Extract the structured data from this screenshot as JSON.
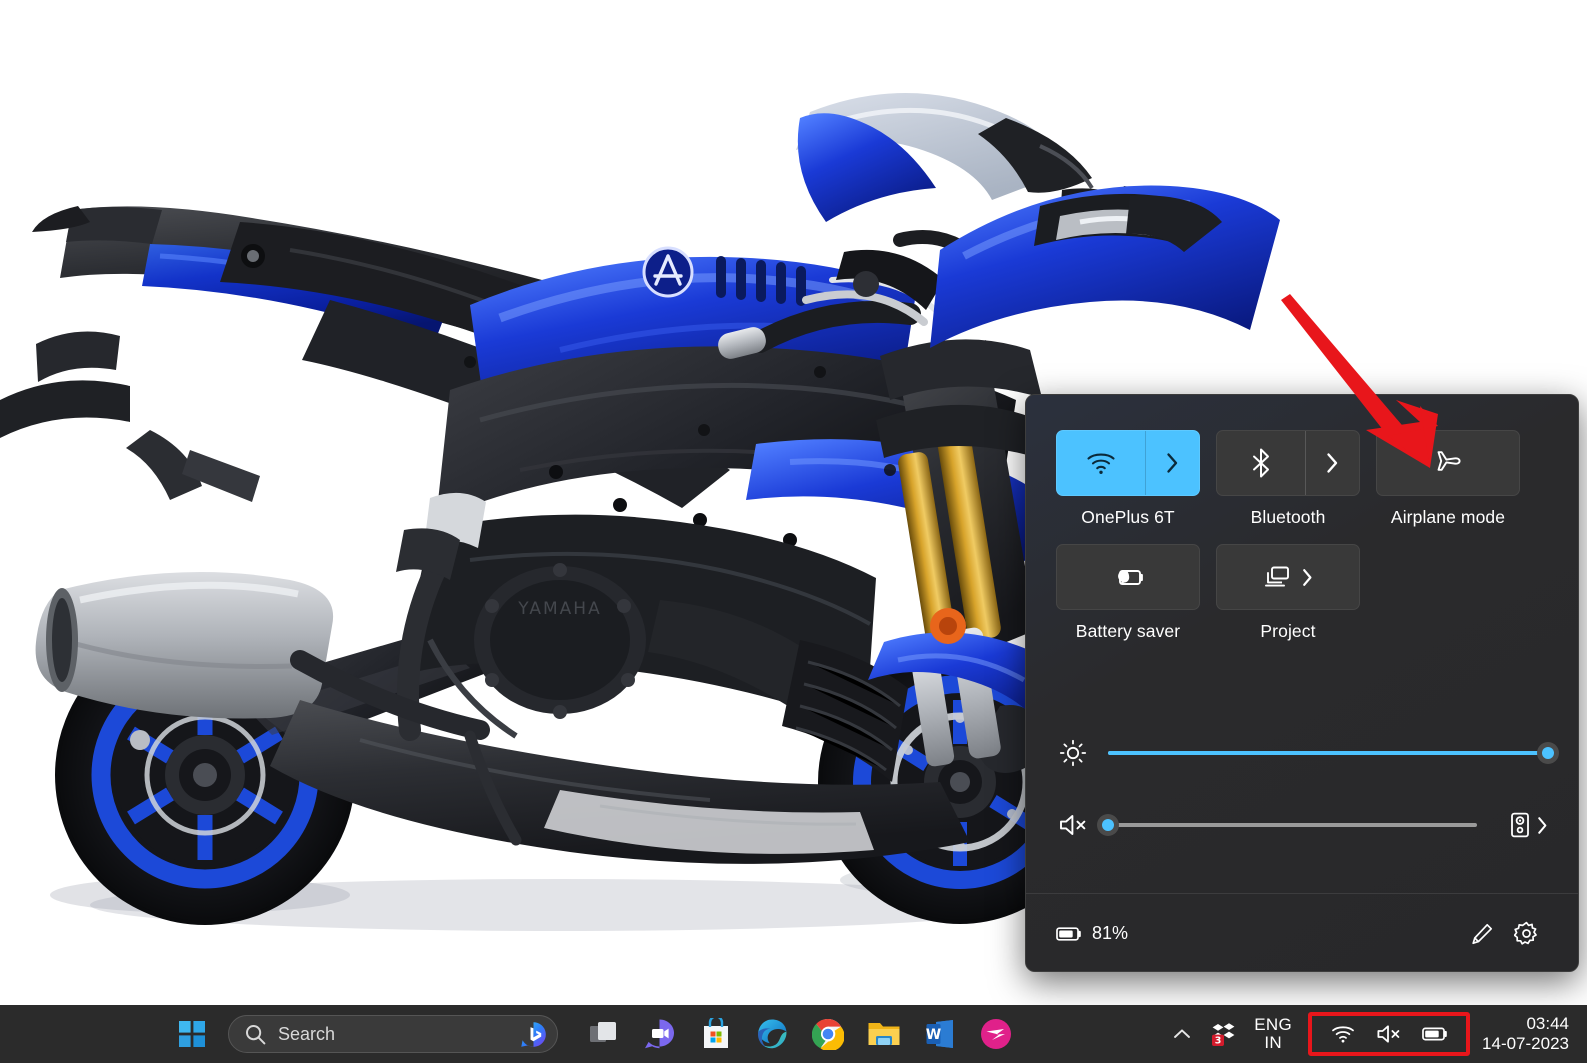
{
  "wallpaper": {
    "description": "Blue and black Yamaha YZF-R1 sportbike on white background",
    "background_color": "#ffffff"
  },
  "quick_settings": {
    "panel_background": "#2b2b2b",
    "accent_color": "#4cc2ff",
    "tiles": [
      {
        "id": "wifi",
        "label": "OnePlus 6T",
        "icon": "wifi-icon",
        "state": "on",
        "has_chevron": true,
        "split": true
      },
      {
        "id": "bluetooth",
        "label": "Bluetooth",
        "icon": "bluetooth-icon",
        "state": "off",
        "has_chevron": true,
        "split": true
      },
      {
        "id": "airplane",
        "label": "Airplane mode",
        "icon": "airplane-icon",
        "state": "off",
        "has_chevron": false,
        "split": false
      },
      {
        "id": "battery-saver",
        "label": "Battery saver",
        "icon": "battery-saver-icon",
        "state": "off",
        "has_chevron": false,
        "split": false
      },
      {
        "id": "project",
        "label": "Project",
        "icon": "project-icon",
        "state": "off",
        "has_chevron": true,
        "split": false
      }
    ],
    "sliders": [
      {
        "id": "brightness",
        "icon": "brightness-icon",
        "value": 100,
        "fill_color": "#4cc2ff"
      },
      {
        "id": "volume",
        "icon": "volume-muted-icon",
        "value": 0,
        "fill_color": "#4cc2ff",
        "output_selector_icon": "audio-output-icon"
      }
    ],
    "footer": {
      "battery_icon": "battery-icon",
      "battery_percent": "81%",
      "edit_icon": "pencil-icon",
      "settings_icon": "gear-icon"
    }
  },
  "annotation": {
    "arrow_color": "#e8161b",
    "points_to": "Airplane mode"
  },
  "taskbar": {
    "background": "#2b2b2b",
    "start_button": {
      "name": "Start",
      "icon": "windows-logo-icon"
    },
    "search": {
      "placeholder": "Search",
      "icon": "search-icon",
      "badge_icon": "bing-chat-icon"
    },
    "apps": [
      {
        "id": "task-view",
        "name": "Task View",
        "icon": "task-view-icon"
      },
      {
        "id": "chat",
        "name": "Chat",
        "icon": "chat-video-icon"
      },
      {
        "id": "store",
        "name": "Microsoft Store",
        "icon": "microsoft-store-icon"
      },
      {
        "id": "edge",
        "name": "Microsoft Edge",
        "icon": "edge-icon"
      },
      {
        "id": "chrome",
        "name": "Google Chrome",
        "icon": "chrome-icon"
      },
      {
        "id": "explorer",
        "name": "File Explorer",
        "icon": "file-explorer-icon"
      },
      {
        "id": "word",
        "name": "Microsoft Word",
        "icon": "word-icon"
      },
      {
        "id": "pink-app",
        "name": "Pinned app",
        "icon": "pink-bird-icon"
      }
    ],
    "tray": {
      "overflow_icon": "chevron-up-icon",
      "notification_icon": "diamonds-icon",
      "notification_badge": "3",
      "language": {
        "line1": "ENG",
        "line2": "IN"
      },
      "highlighted_group": {
        "highlight_color": "#e8161b",
        "items": [
          {
            "id": "wifi",
            "icon": "wifi-icon"
          },
          {
            "id": "volume",
            "icon": "volume-muted-icon"
          },
          {
            "id": "battery",
            "icon": "battery-icon"
          }
        ]
      },
      "clock": {
        "time": "03:44",
        "date": "14-07-2023"
      }
    }
  }
}
